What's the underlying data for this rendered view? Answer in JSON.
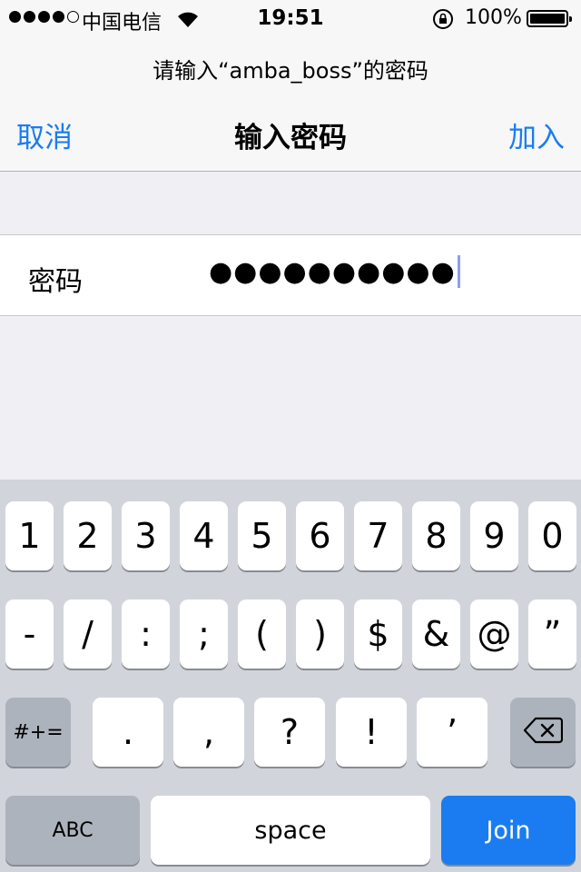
{
  "status_bar": {
    "carrier": "中国电信",
    "time": "19:51",
    "battery": "100%",
    "signal_bars_filled": 4,
    "signal_bars_total": 5
  },
  "prompt": "请输入“amba_boss”的密码",
  "nav": {
    "cancel": "取消",
    "title": "输入密码",
    "join": "加入"
  },
  "password_field": {
    "label": "密码",
    "value": "●●●●●●●●●●"
  },
  "keyboard": {
    "row1": [
      "1",
      "2",
      "3",
      "4",
      "5",
      "6",
      "7",
      "8",
      "9",
      "0"
    ],
    "row2": [
      "-",
      "/",
      ":",
      ";",
      "(",
      ")",
      "$",
      "&",
      "@",
      "”"
    ],
    "row3_left": "#+=",
    "row3": [
      ".",
      ",",
      "?",
      "!",
      "’"
    ],
    "row3_right": "delete-icon",
    "row4": {
      "abc": "ABC",
      "space": "space",
      "join": "Join"
    }
  },
  "colors": {
    "accent": "#1a7cf0",
    "background": "#efeff4",
    "keyboard_bg": "#d1d5db"
  }
}
